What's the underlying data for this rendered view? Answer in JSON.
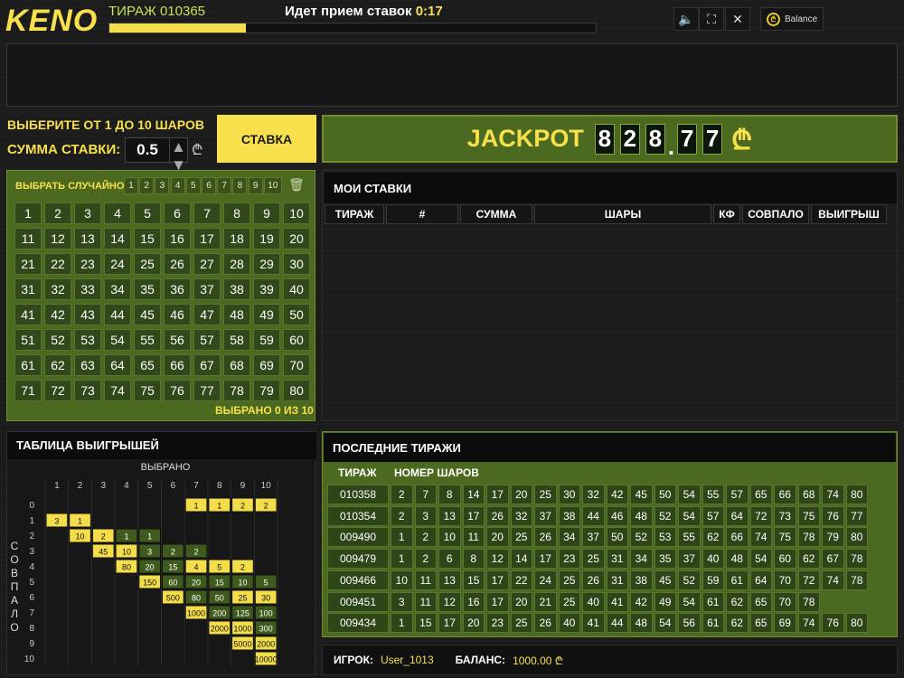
{
  "header": {
    "logo": "KENO",
    "draw_label": "ТИРАЖ 010365",
    "accept_label": "Идет прием ставок",
    "accept_time": "0:17",
    "progress": 0.28,
    "balance_label": "Balance",
    "icons": [
      "volume-icon",
      "fullscreen-icon",
      "close-icon",
      "coin-icon"
    ]
  },
  "bet": {
    "choose_label": "ВЫБЕРИТЕ ОТ 1 ДО 10 ШАРОВ",
    "sum_label": "СУММА СТАВКИ:",
    "amount": "0.5",
    "currency": "₾",
    "bet_button": "СТАВКА"
  },
  "jackpot": {
    "label": "JACKPOT",
    "digits_int": [
      "8",
      "2",
      "8"
    ],
    "digits_frac": [
      "7",
      "7"
    ],
    "dot": ".",
    "currency": "₾"
  },
  "board": {
    "random_label": "ВЫБРАТЬ СЛУЧАЙНО:",
    "random_options": [
      "1",
      "2",
      "3",
      "4",
      "5",
      "6",
      "7",
      "8",
      "9",
      "10"
    ],
    "chosen_label": "ВЫБРАНО 0 ИЗ 10",
    "numbers_count": 80
  },
  "paytable": {
    "title": "ТАБЛИЦА ВЫИГРЫШЕЙ",
    "x_label": "ВЫБРАНО",
    "y_label": "СОВПАЛО",
    "picked": [
      "1",
      "2",
      "3",
      "4",
      "5",
      "6",
      "7",
      "8",
      "9",
      "10"
    ],
    "matched": [
      "0",
      "1",
      "2",
      "3",
      "4",
      "5",
      "6",
      "7",
      "8",
      "9",
      "10"
    ],
    "rows": [
      {
        "m": 0,
        "cells": [
          [
            7,
            "1"
          ],
          [
            8,
            "1"
          ],
          [
            9,
            "2"
          ],
          [
            10,
            "2"
          ]
        ]
      },
      {
        "m": 1,
        "cells": [
          [
            1,
            "3"
          ],
          [
            2,
            "1"
          ]
        ]
      },
      {
        "m": 2,
        "cells": [
          [
            2,
            "10"
          ],
          [
            3,
            "2"
          ],
          [
            4,
            "1"
          ],
          [
            5,
            "1"
          ]
        ]
      },
      {
        "m": 3,
        "cells": [
          [
            3,
            "45"
          ],
          [
            4,
            "10"
          ],
          [
            5,
            "3"
          ],
          [
            6,
            "2"
          ],
          [
            7,
            "2"
          ]
        ]
      },
      {
        "m": 4,
        "cells": [
          [
            4,
            "80"
          ],
          [
            5,
            "20"
          ],
          [
            6,
            "15"
          ],
          [
            7,
            "4"
          ],
          [
            8,
            "5"
          ],
          [
            9,
            "2"
          ]
        ]
      },
      {
        "m": 5,
        "cells": [
          [
            5,
            "150"
          ],
          [
            6,
            "60"
          ],
          [
            7,
            "20"
          ],
          [
            8,
            "15"
          ],
          [
            9,
            "10"
          ],
          [
            10,
            "5"
          ]
        ]
      },
      {
        "m": 6,
        "cells": [
          [
            6,
            "500"
          ],
          [
            7,
            "80"
          ],
          [
            8,
            "50"
          ],
          [
            9,
            "25"
          ],
          [
            10,
            "30"
          ]
        ]
      },
      {
        "m": 7,
        "cells": [
          [
            7,
            "1000"
          ],
          [
            8,
            "200"
          ],
          [
            9,
            "125"
          ],
          [
            10,
            "100"
          ]
        ]
      },
      {
        "m": 8,
        "cells": [
          [
            8,
            "2000"
          ],
          [
            9,
            "1000"
          ],
          [
            10,
            "300"
          ]
        ]
      },
      {
        "m": 9,
        "cells": [
          [
            9,
            "5000"
          ],
          [
            10,
            "2000"
          ]
        ]
      },
      {
        "m": 10,
        "cells": [
          [
            10,
            "10000"
          ]
        ]
      }
    ]
  },
  "mybets": {
    "title": "МОИ СТАВКИ",
    "columns": [
      "ТИРАЖ",
      "#",
      "СУММА",
      "ШАРЫ",
      "КФ",
      "СОВПАЛО",
      "ВЫИГРЫШ"
    ]
  },
  "last_draws": {
    "title": "ПОСЛЕДНИЕ ТИРАЖИ",
    "col_draw": "ТИРАЖ",
    "col_balls": "НОМЕР ШАРОВ",
    "rows": [
      {
        "draw": "010358",
        "balls": [
          "2",
          "7",
          "8",
          "14",
          "17",
          "20",
          "25",
          "30",
          "32",
          "42",
          "45",
          "50",
          "54",
          "55",
          "57",
          "65",
          "66",
          "68",
          "74",
          "80"
        ]
      },
      {
        "draw": "010354",
        "balls": [
          "2",
          "3",
          "13",
          "17",
          "26",
          "32",
          "37",
          "38",
          "44",
          "46",
          "48",
          "52",
          "54",
          "57",
          "64",
          "72",
          "73",
          "75",
          "76",
          "77"
        ]
      },
      {
        "draw": "009490",
        "balls": [
          "1",
          "2",
          "10",
          "11",
          "20",
          "25",
          "26",
          "34",
          "37",
          "50",
          "52",
          "53",
          "55",
          "62",
          "66",
          "74",
          "75",
          "78",
          "79",
          "80"
        ]
      },
      {
        "draw": "009479",
        "balls": [
          "1",
          "2",
          "6",
          "8",
          "12",
          "14",
          "17",
          "23",
          "25",
          "31",
          "34",
          "35",
          "37",
          "40",
          "48",
          "54",
          "60",
          "62",
          "67",
          "78"
        ]
      },
      {
        "draw": "009466",
        "balls": [
          "10",
          "11",
          "13",
          "15",
          "17",
          "22",
          "24",
          "25",
          "26",
          "31",
          "38",
          "45",
          "52",
          "59",
          "61",
          "64",
          "70",
          "72",
          "74",
          "78"
        ]
      },
      {
        "draw": "009451",
        "balls": [
          "3",
          "11",
          "12",
          "16",
          "17",
          "20",
          "21",
          "25",
          "40",
          "41",
          "42",
          "49",
          "54",
          "61",
          "62",
          "65",
          "70",
          "78"
        ]
      },
      {
        "draw": "009434",
        "balls": [
          "1",
          "15",
          "17",
          "20",
          "23",
          "25",
          "26",
          "40",
          "41",
          "44",
          "48",
          "54",
          "56",
          "61",
          "62",
          "65",
          "69",
          "74",
          "76",
          "80"
        ]
      }
    ]
  },
  "footer": {
    "player_label": "ИГРОК:",
    "player": "User_1013",
    "balance_label": "БАЛАНС:",
    "balance": "1000.00 ₾"
  }
}
